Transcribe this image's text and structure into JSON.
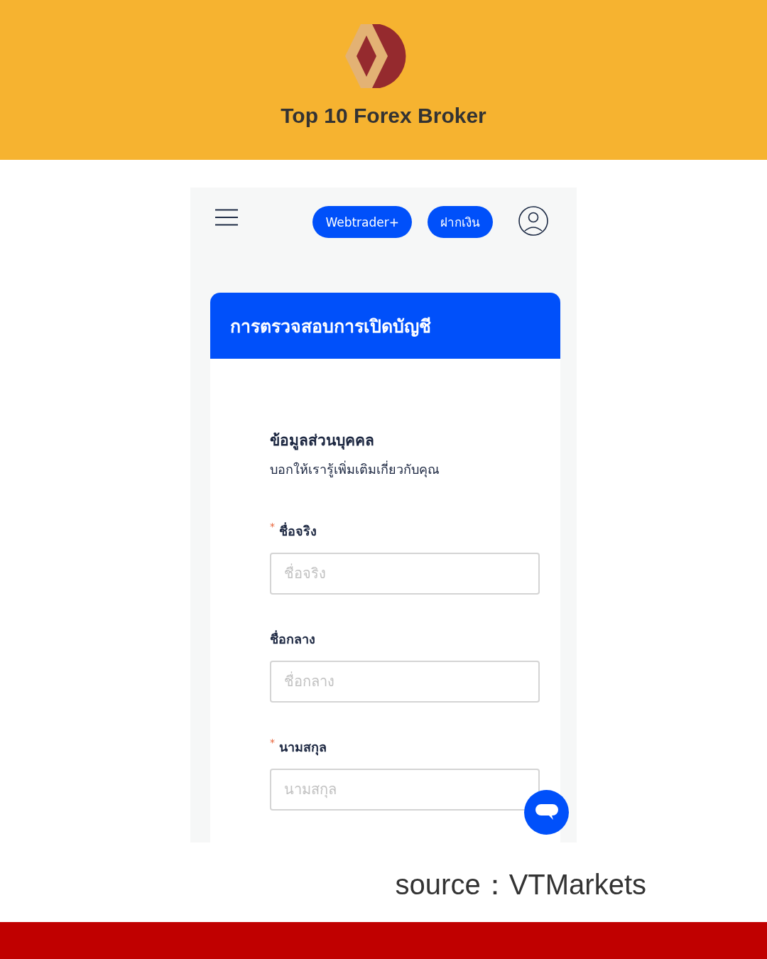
{
  "banner": {
    "title": "Top 10 Forex Broker"
  },
  "screen": {
    "top_bar": {
      "buttons": [
        "Webtrader+",
        "ฝากเงิน"
      ]
    },
    "form": {
      "title": "การตรวจสอบการเปิดบัญชี",
      "section_title": "ข้อมูลส่วนบุคคล",
      "section_subtitle": "บอกให้เรารู้เพิ่มเติมเกี่ยวกับคุณ",
      "fields": [
        {
          "label": "ชื่อจริง",
          "required": true,
          "required_mark": "*",
          "placeholder": "ชื่อจริง"
        },
        {
          "label": "ชื่อกลาง",
          "required": false,
          "placeholder": "ชื่อกลาง"
        },
        {
          "label": "นามสกุล",
          "required": true,
          "required_mark": "*",
          "placeholder": "นามสกุล"
        }
      ]
    }
  },
  "source": "source：VTMarkets"
}
